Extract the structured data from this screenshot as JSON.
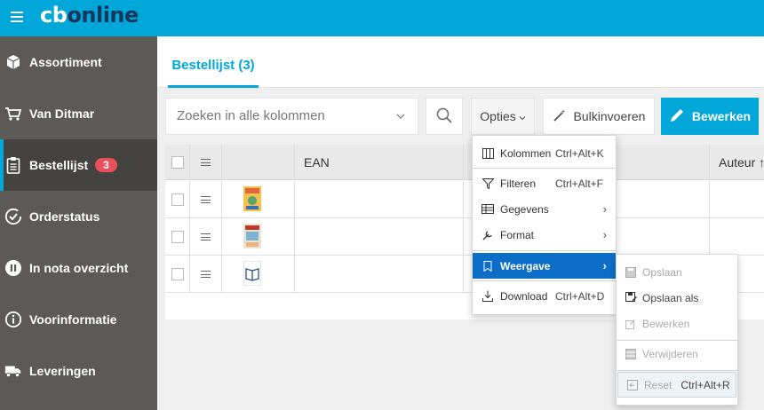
{
  "brand": {
    "logo_cb": "cb",
    "logo_online": "online"
  },
  "sidebar": {
    "items": [
      {
        "label": "Assortiment",
        "icon": "box-icon"
      },
      {
        "label": "Van Ditmar",
        "icon": "cart-icon"
      },
      {
        "label": "Bestellijst",
        "icon": "clipboard-icon",
        "badge": "3",
        "active": true
      },
      {
        "label": "Orderstatus",
        "icon": "check-circle-icon"
      },
      {
        "label": "In nota overzicht",
        "icon": "pause-circle-icon"
      },
      {
        "label": "Voorinformatie",
        "icon": "info-circle-icon"
      },
      {
        "label": "Leveringen",
        "icon": "truck-icon"
      }
    ]
  },
  "tabs": {
    "active_label": "Bestellijst (3)"
  },
  "toolbar": {
    "search_placeholder": "Zoeken in alle kolommen",
    "opties_label": "Opties",
    "bulk_label": "Bulkinvoeren",
    "bewerken_label": "Bewerken"
  },
  "grid": {
    "columns": [
      "EAN",
      "Auteur ↑"
    ],
    "rows": 3
  },
  "options_menu": {
    "items": [
      {
        "label": "Kolommen",
        "shortcut": "Ctrl+Alt+K",
        "icon": "columns-icon"
      },
      {
        "label": "Filteren",
        "shortcut": "Ctrl+Alt+F",
        "icon": "filter-icon"
      },
      {
        "label": "Gegevens",
        "icon": "table-icon"
      },
      {
        "label": "Format",
        "icon": "wrench-icon"
      },
      {
        "label": "Weergave",
        "icon": "bookmark-icon"
      },
      {
        "label": "Download",
        "shortcut": "Ctrl+Alt+D",
        "icon": "download-icon"
      }
    ]
  },
  "weergave_menu": {
    "items": [
      {
        "label": "Opslaan",
        "icon": "save-icon",
        "disabled": true
      },
      {
        "label": "Opslaan als",
        "icon": "save-as-icon",
        "disabled": false
      },
      {
        "label": "Bewerken",
        "icon": "edit-icon",
        "disabled": true
      },
      {
        "label": "Verwijderen",
        "icon": "delete-icon",
        "disabled": true
      },
      {
        "label": "Reset",
        "shortcut": "Ctrl+Alt+R",
        "icon": "reset-icon",
        "disabled": true
      }
    ]
  },
  "colors": {
    "accent": "#00a7d8",
    "sidebar": "#5b5a56",
    "sidebar_active": "#444340",
    "badge": "#e8505b",
    "menu_selected": "#0d6ec8",
    "brand_dark": "#17365d"
  }
}
